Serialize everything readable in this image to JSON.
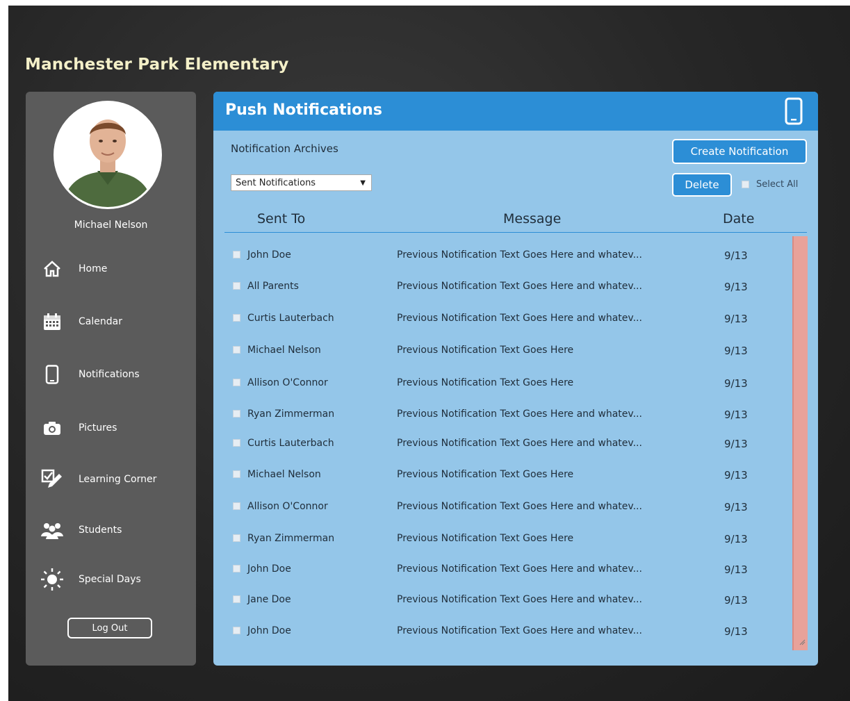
{
  "app": {
    "school_name": "Manchester Park Elementary"
  },
  "sidebar": {
    "user_name": "Michael Nelson",
    "items": [
      {
        "label": "Home",
        "icon": "home-icon"
      },
      {
        "label": "Calendar",
        "icon": "calendar-icon"
      },
      {
        "label": "Notifications",
        "icon": "phone-icon"
      },
      {
        "label": "Pictures",
        "icon": "camera-icon"
      },
      {
        "label": "Learning Corner",
        "icon": "checklist-pencil-icon"
      },
      {
        "label": "Students",
        "icon": "people-icon"
      },
      {
        "label": "Special Days",
        "icon": "sun-icon"
      }
    ],
    "logout_label": "Log Out"
  },
  "panel": {
    "title": "Push Notifications",
    "header_icon": "phone-icon",
    "archives_label": "Notification Archives",
    "select_value": "Sent Notifications",
    "create_label": "Create Notification",
    "delete_label": "Delete",
    "select_all_label": "Select All",
    "columns": [
      "Sent To",
      "Message",
      "Date"
    ],
    "rows": [
      {
        "to": "John Doe",
        "message": "Previous Notification Text Goes Here and whatev...",
        "date": "9/13"
      },
      {
        "to": "All Parents",
        "message": "Previous Notification Text Goes Here and whatev...",
        "date": "9/13"
      },
      {
        "to": "Curtis Lauterbach",
        "message": "Previous Notification Text Goes Here and whatev...",
        "date": "9/13"
      },
      {
        "to": "Michael Nelson",
        "message": "Previous Notification Text Goes Here",
        "date": "9/13"
      },
      {
        "to": "Allison O'Connor",
        "message": "Previous Notification Text Goes Here",
        "date": "9/13"
      },
      {
        "to": "Ryan Zimmerman",
        "message": "Previous Notification Text Goes Here and whatev...",
        "date": "9/13"
      },
      {
        "to": "Curtis Lauterbach",
        "message": "Previous Notification Text Goes Here and whatev...",
        "date": "9/13"
      },
      {
        "to": "Michael Nelson",
        "message": "Previous Notification Text Goes Here",
        "date": "9/13"
      },
      {
        "to": "Allison O'Connor",
        "message": "Previous Notification Text Goes Here and whatev...",
        "date": "9/13"
      },
      {
        "to": "Ryan Zimmerman",
        "message": "Previous Notification Text Goes Here",
        "date": "9/13"
      },
      {
        "to": "John Doe",
        "message": "Previous Notification Text Goes Here and whatev...",
        "date": "9/13"
      },
      {
        "to": "Jane Doe",
        "message": "Previous Notification Text Goes Here and whatev...",
        "date": "9/13"
      },
      {
        "to": "John Doe",
        "message": "Previous Notification Text Goes Here and whatev...",
        "date": "9/13"
      }
    ]
  },
  "colors": {
    "panel_header": "#2c8ed6",
    "panel_body": "#94c6e9",
    "sidebar": "#5b5b5b",
    "scrollbar": "#e8a29a",
    "title_text": "#f4f0c8"
  }
}
